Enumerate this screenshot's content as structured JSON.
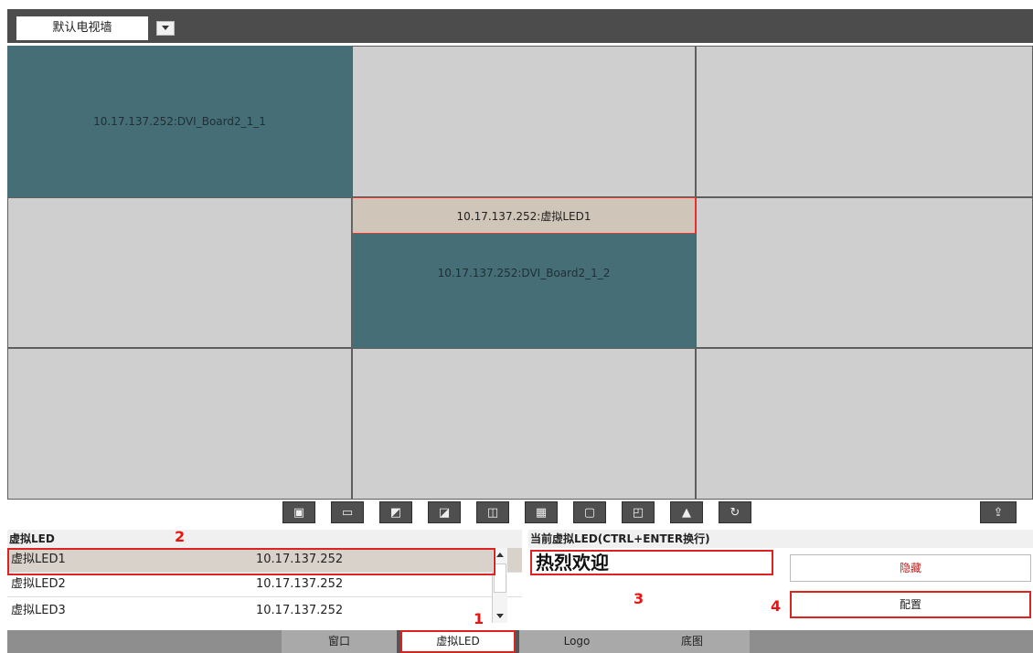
{
  "topbar": {
    "wall_name": "默认电视墙"
  },
  "grid": {
    "window1_label": "10.17.137.252:DVI_Board2_1_1",
    "window2_label": "10.17.137.252:DVI_Board2_1_2",
    "led_label": "10.17.137.252:虚拟LED1"
  },
  "toolbar": {
    "icons": [
      "open-window-icon",
      "monitor-icon",
      "close-window-icon",
      "layer-up-icon",
      "layer-down-icon",
      "split-icon",
      "fullscreen-icon",
      "roam-icon",
      "align-icon",
      "refresh-icon"
    ],
    "right_icon": "export-icon"
  },
  "led_list": {
    "title": "虚拟LED",
    "rows": [
      {
        "name": "虚拟LED1",
        "ip": "10.17.137.252"
      },
      {
        "name": "虚拟LED2",
        "ip": "10.17.137.252"
      },
      {
        "name": "虚拟LED3",
        "ip": "10.17.137.252"
      }
    ]
  },
  "current_led": {
    "title": "当前虚拟LED(CTRL+ENTER换行)",
    "text": "热烈欢迎",
    "hide_label": "隐藏",
    "config_label": "配置"
  },
  "tabs": [
    "窗口",
    "虚拟LED",
    "Logo",
    "底图"
  ],
  "annotations": [
    "1",
    "2",
    "3",
    "4"
  ],
  "colors": {
    "window": "#456e77",
    "highlight": "#d22",
    "led_overlay": "#cfc5b9"
  }
}
